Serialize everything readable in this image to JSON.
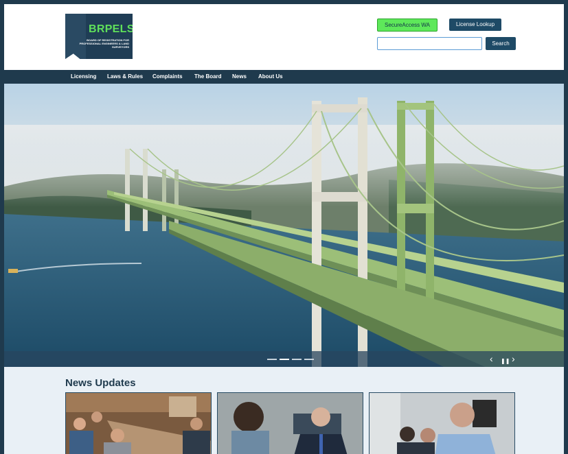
{
  "logo": {
    "title": "BRPELS",
    "subtitle": "BOARD OF REGISTRATION FOR PROFESSIONAL ENGINEERS & LAND SURVEYORS"
  },
  "header": {
    "secure_access_label": "SecureAccess WA",
    "license_lookup_label": "License Lookup",
    "search_placeholder": "",
    "search_label": "Search"
  },
  "nav": {
    "items": [
      "Licensing",
      "Laws & Rules",
      "Complaints",
      "The Board",
      "News",
      "About Us"
    ]
  },
  "hero": {
    "image": "Tacoma Narrows Bridge aerial photo in morning fog",
    "slides": 4,
    "active_slide": 2,
    "controls": {
      "prev": "‹",
      "pause": "❚❚",
      "next": "›"
    }
  },
  "news": {
    "title": "News Updates",
    "cards": [
      "meeting-photo",
      "speaker-photo",
      "presenter-photo"
    ]
  },
  "colors": {
    "navy": "#1f3a4d",
    "brand_green": "#5fe05a",
    "button_blue": "#1e4a66",
    "news_bg": "#e9f0f6"
  }
}
